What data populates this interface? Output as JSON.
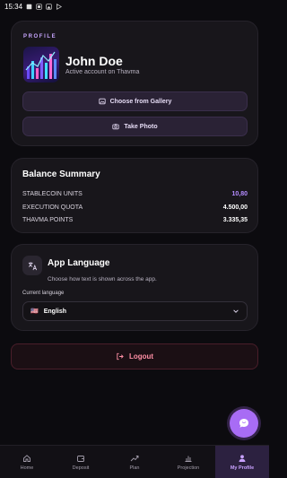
{
  "status_bar": {
    "time": "15:34"
  },
  "profile": {
    "section_label": "PROFILE",
    "name": "John Doe",
    "subtitle": "Active account on Thavma",
    "gallery_button": "Choose from Gallery",
    "photo_button": "Take Photo"
  },
  "balance": {
    "title": "Balance Summary",
    "rows": [
      {
        "label": "STABLECOIN UNITS",
        "value": "10,80"
      },
      {
        "label": "EXECUTION QUOTA",
        "value": "4.500,00"
      },
      {
        "label": "THAVMA POINTS",
        "value": "3.335,35"
      }
    ]
  },
  "language": {
    "title": "App Language",
    "description": "Choose how text is shown across the app.",
    "current_label": "Current language",
    "selected_flag": "🇺🇸",
    "selected": "English"
  },
  "logout": {
    "label": "Logout"
  },
  "nav": [
    {
      "label": "Home",
      "icon": "home-icon"
    },
    {
      "label": "Deposit",
      "icon": "wallet-icon"
    },
    {
      "label": "Plan",
      "icon": "trend-icon"
    },
    {
      "label": "Projection",
      "icon": "bar-chart-icon"
    },
    {
      "label": "My Profile",
      "icon": "user-icon"
    }
  ],
  "colors": {
    "accent": "#b48cff",
    "logout_text": "#ff8fa5",
    "fab": "#a86cf5"
  }
}
